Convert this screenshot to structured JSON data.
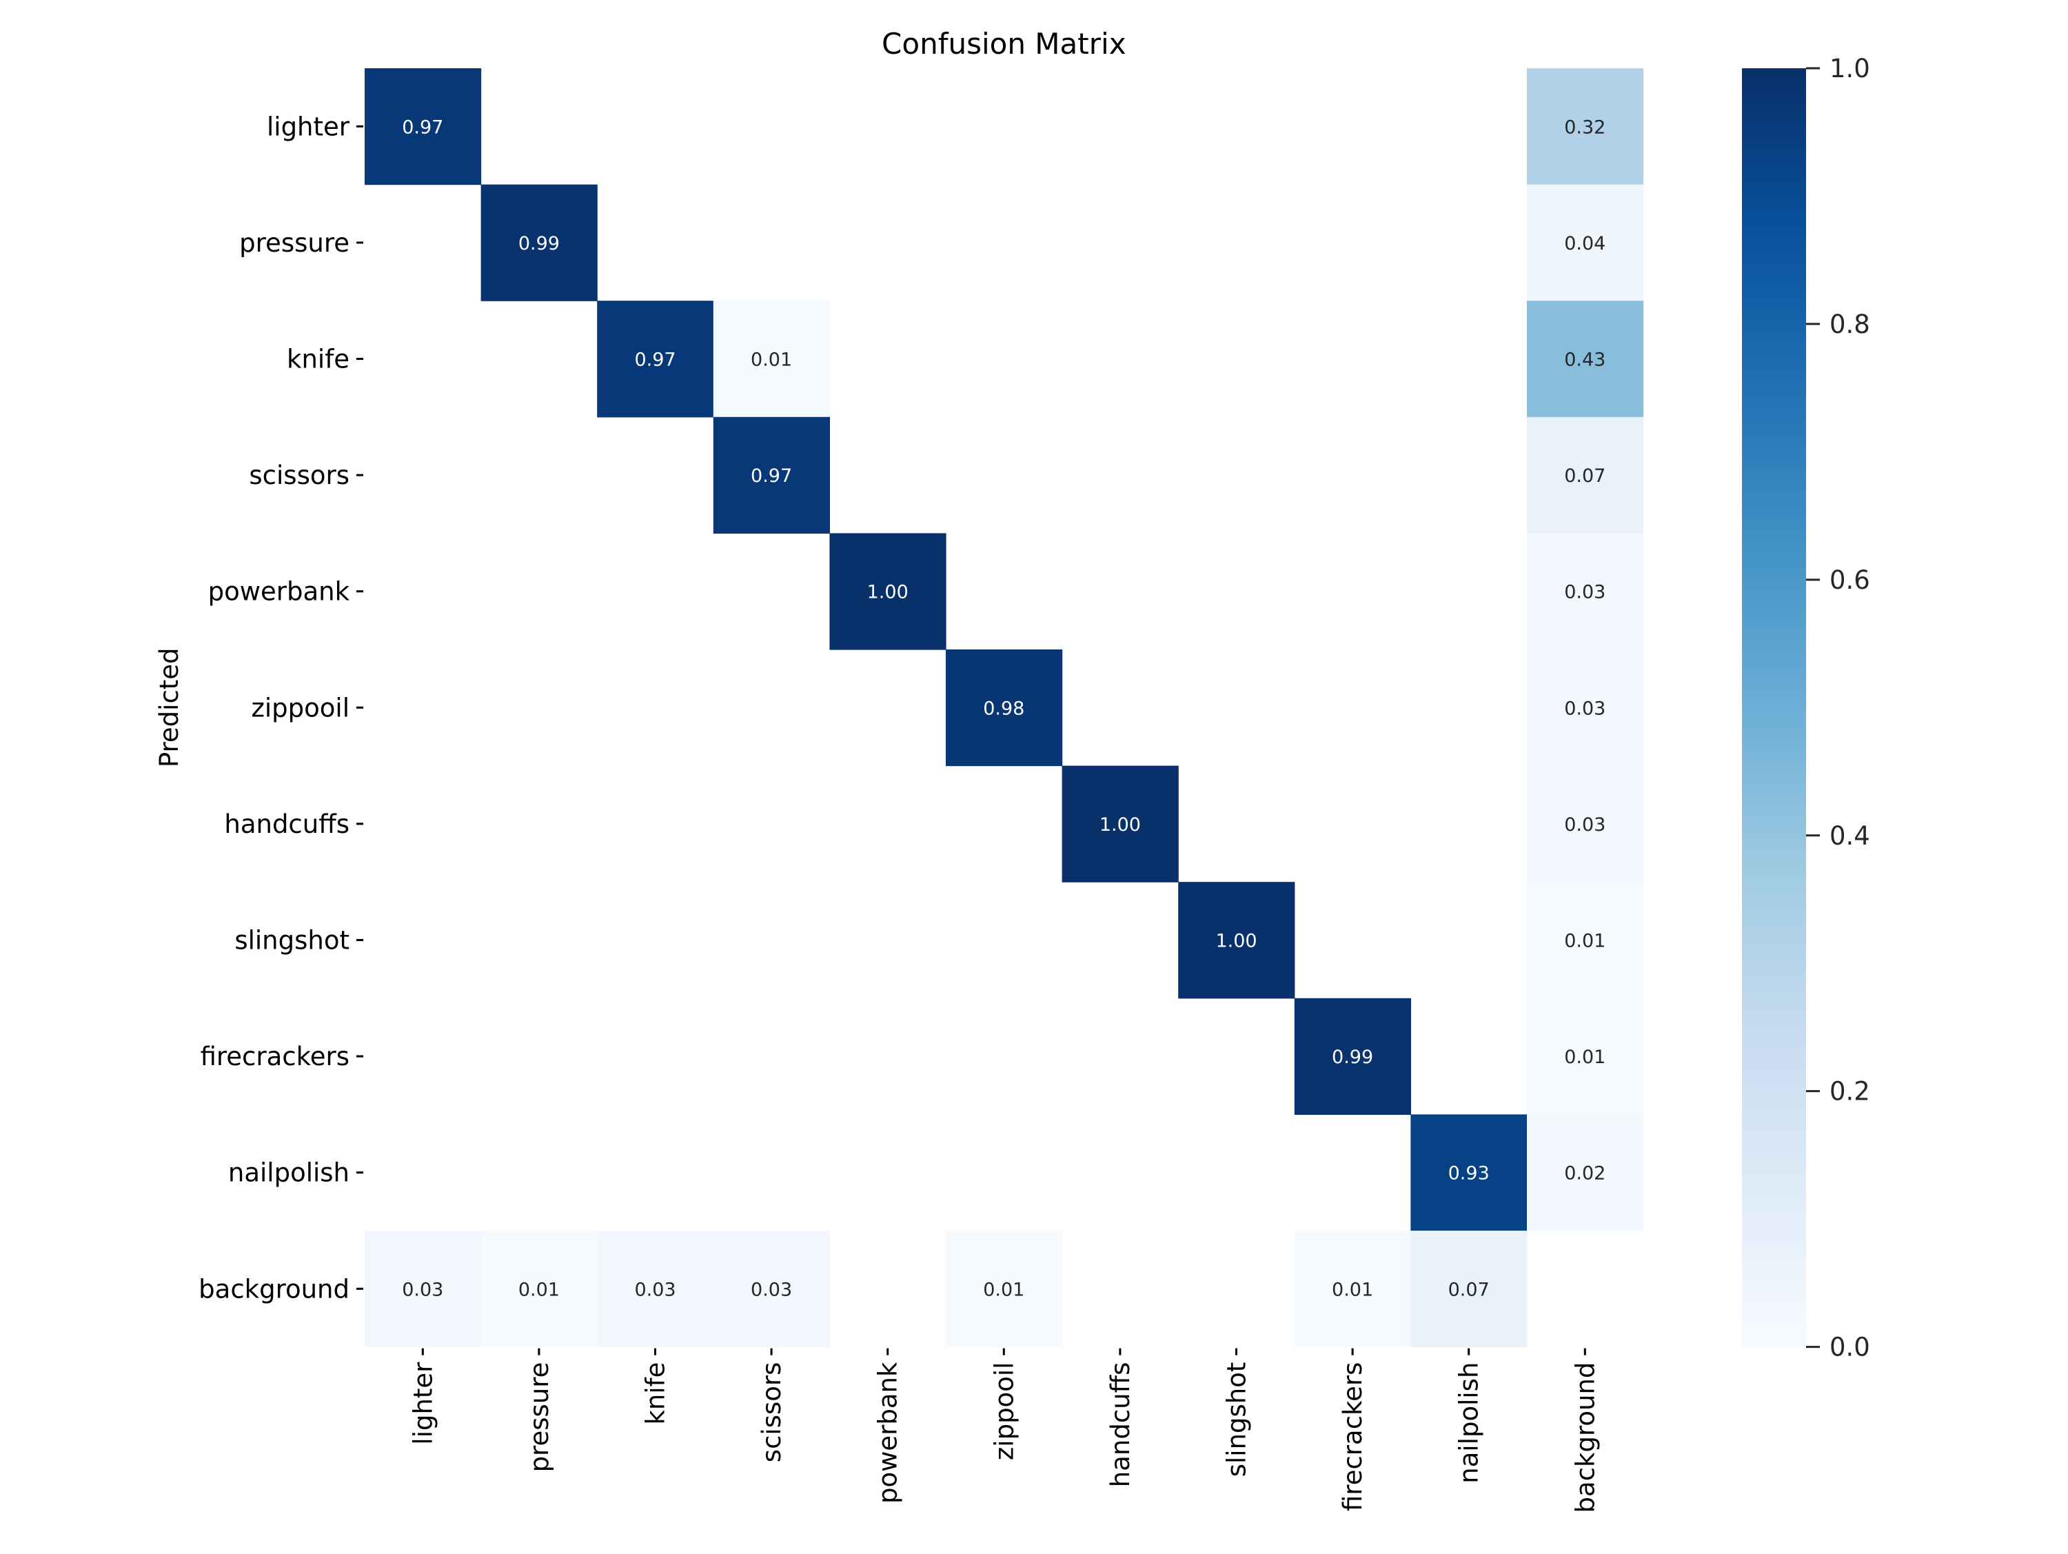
{
  "chart_data": {
    "type": "heatmap",
    "title": "Confusion Matrix",
    "xlabel": "",
    "ylabel": "Predicted",
    "x_categories": [
      "lighter",
      "pressure",
      "knife",
      "scissors",
      "powerbank",
      "zippooil",
      "handcuffs",
      "slingshot",
      "firecrackers",
      "nailpolish",
      "background"
    ],
    "y_categories": [
      "lighter",
      "pressure",
      "knife",
      "scissors",
      "powerbank",
      "zippooil",
      "handcuffs",
      "slingshot",
      "firecrackers",
      "nailpolish",
      "background"
    ],
    "values": [
      [
        0.97,
        null,
        null,
        null,
        null,
        null,
        null,
        null,
        null,
        null,
        0.32
      ],
      [
        null,
        0.99,
        null,
        null,
        null,
        null,
        null,
        null,
        null,
        null,
        0.04
      ],
      [
        null,
        null,
        0.97,
        0.01,
        null,
        null,
        null,
        null,
        null,
        null,
        0.43
      ],
      [
        null,
        null,
        null,
        0.97,
        null,
        null,
        null,
        null,
        null,
        null,
        0.07
      ],
      [
        null,
        null,
        null,
        null,
        1.0,
        null,
        null,
        null,
        null,
        null,
        0.03
      ],
      [
        null,
        null,
        null,
        null,
        null,
        0.98,
        null,
        null,
        null,
        null,
        0.03
      ],
      [
        null,
        null,
        null,
        null,
        null,
        null,
        1.0,
        null,
        null,
        null,
        0.03
      ],
      [
        null,
        null,
        null,
        null,
        null,
        null,
        null,
        1.0,
        null,
        null,
        0.01
      ],
      [
        null,
        null,
        null,
        null,
        null,
        null,
        null,
        null,
        0.99,
        null,
        0.01
      ],
      [
        null,
        null,
        null,
        null,
        null,
        null,
        null,
        null,
        null,
        0.93,
        0.02
      ],
      [
        0.03,
        0.01,
        0.03,
        0.03,
        null,
        0.01,
        null,
        null,
        0.01,
        0.07,
        null
      ]
    ],
    "value_format": "0.00",
    "colormap": "Blues",
    "vmin": 0.0,
    "vmax": 1.0,
    "colorbar": {
      "ticks": [
        0.0,
        0.2,
        0.4,
        0.6,
        0.8,
        1.0
      ],
      "tick_labels": [
        "0.0",
        "0.2",
        "0.4",
        "0.6",
        "0.8",
        "1.0"
      ],
      "placement": "right"
    },
    "grid": false,
    "annot_text_colors": {
      "dark": "#ffffff",
      "light": "#262626"
    }
  }
}
